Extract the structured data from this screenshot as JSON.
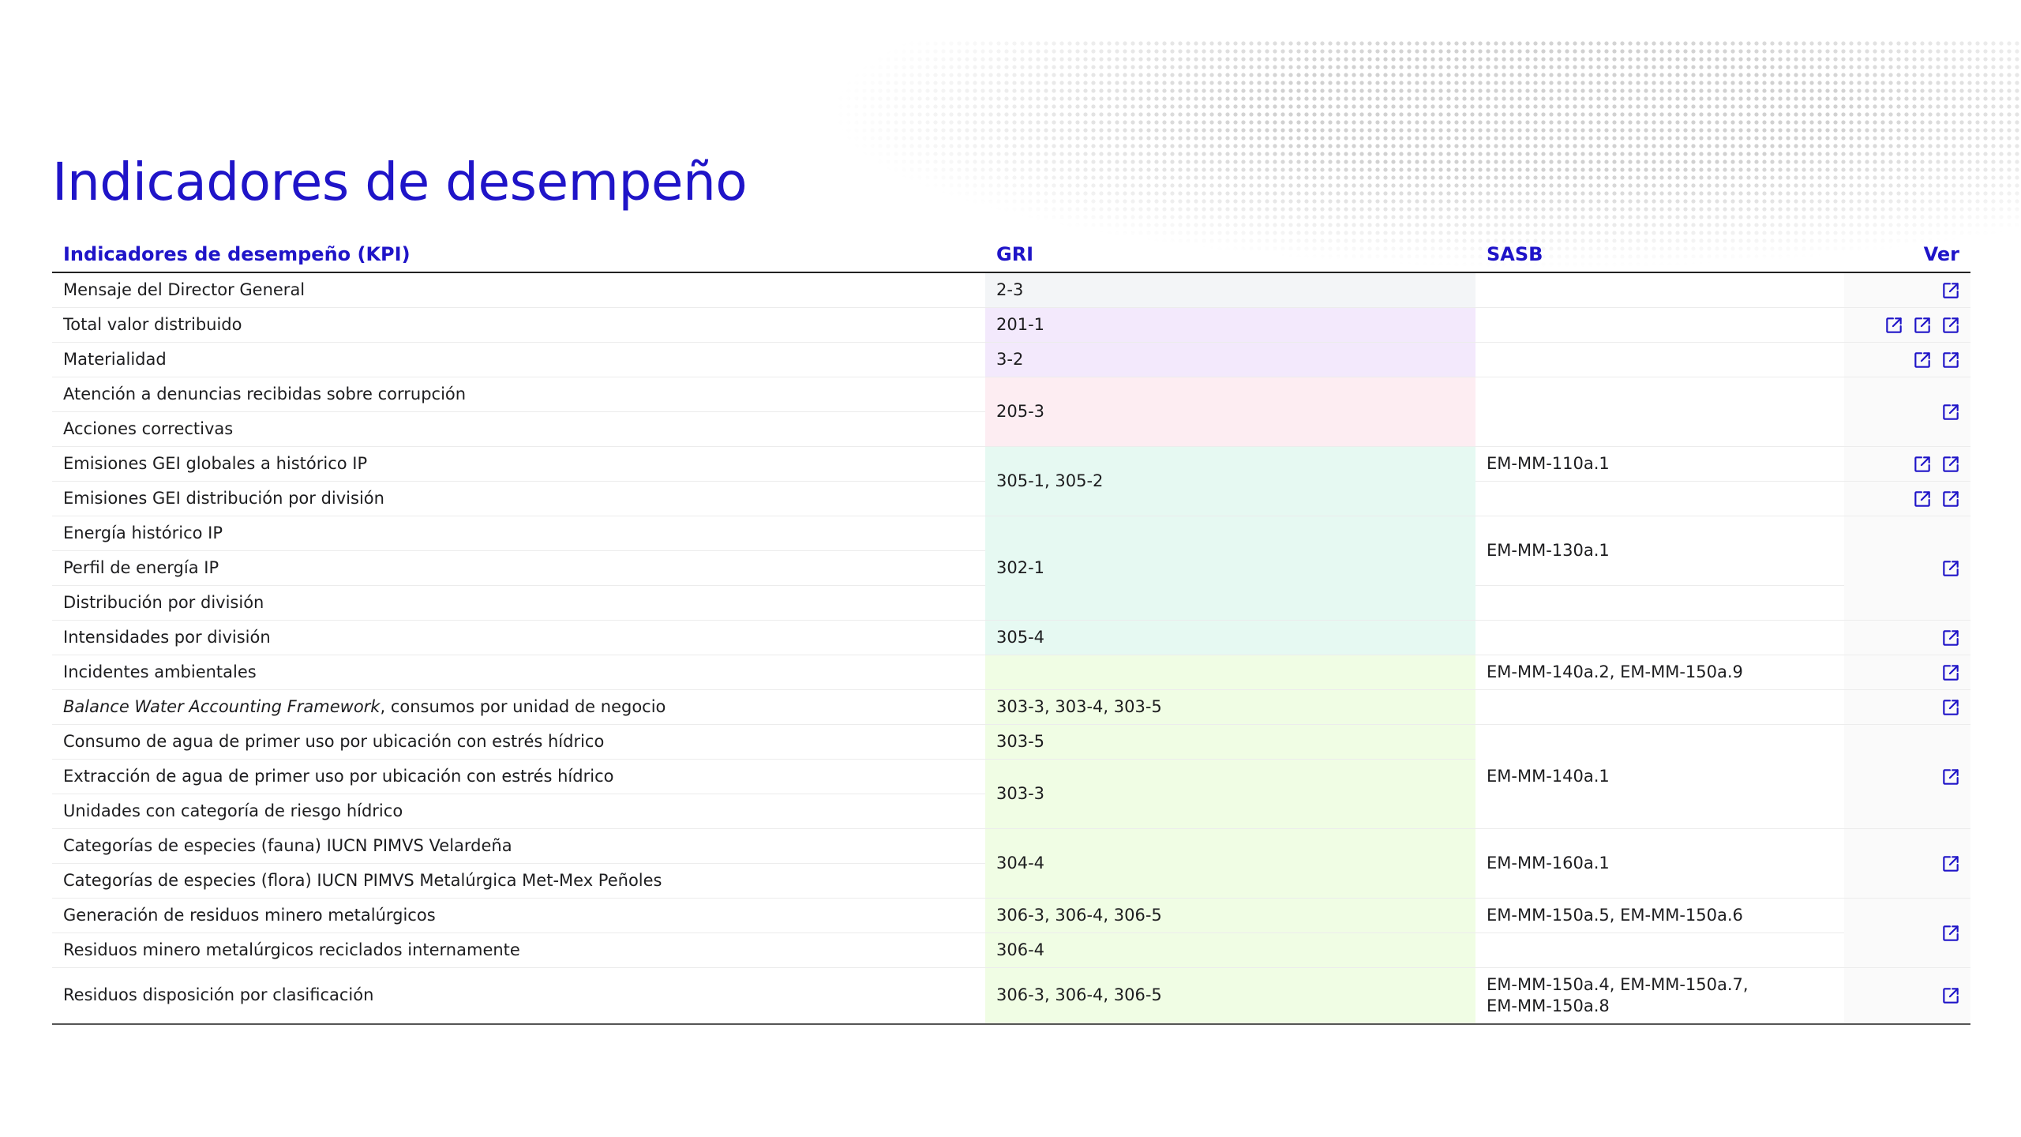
{
  "page": {
    "title": "Indicadores de desempeño"
  },
  "table": {
    "headers": {
      "kpi": "Indicadores de desempeño (KPI)",
      "gri": "GRI",
      "sasb": "SASB",
      "ver": "Ver"
    },
    "kpi": [
      "Mensaje del Director General",
      "Total valor distribuido",
      "Materialidad",
      "Atención a denuncias recibidas sobre corrupción",
      "Acciones correctivas",
      "Emisiones GEI globales a histórico IP",
      "Emisiones GEI distribución por división",
      "Energía histórico IP",
      "Perfil de energía IP",
      "Distribución por división",
      "Intensidades por división",
      "Incidentes ambientales",
      "Balance Water Accounting Framework",
      ", consumos por unidad de negocio",
      "Consumo de agua de primer uso por ubicación con estrés hídrico",
      "Extracción de agua de primer uso por ubicación con estrés hídrico",
      "Unidades con categoría de riesgo hídrico",
      "Categorías de especies (fauna) IUCN PIMVS Velardeña",
      "Categorías de especies (flora) IUCN PIMVS Metalúrgica Met-Mex Peñoles",
      "Generación de residuos minero metalúrgicos",
      "Residuos minero metalúrgicos reciclados internamente",
      "Residuos disposición por clasificación"
    ],
    "gri": [
      "2-3",
      "201-1",
      "3-2",
      "205-3",
      "305-1, 305-2",
      "302-1",
      "305-4",
      "303-3, 303-4, 303-5",
      "303-5",
      "303-3",
      "304-4",
      "306-3, 306-4, 306-5",
      "306-4",
      "306-3, 306-4, 306-5"
    ],
    "sasb": [
      "EM-MM-110a.1",
      "EM-MM-130a.1",
      "EM-MM-140a.2, EM-MM-150a.9",
      "EM-MM-140a.1",
      "EM-MM-160a.1",
      "EM-MM-150a.5, EM-MM-150a.6",
      "EM-MM-150a.4, EM-MM-150a.7,",
      "EM-MM-150a.8"
    ],
    "gri_colors": {
      "gray": "#f3f5f7",
      "purple": "#f3e9fc",
      "pink": "#fdedf2",
      "mint": "#e6f9f2",
      "lime": "#f0fde4"
    },
    "accent_color": "#1f14c8",
    "link_icon": "external-link-icon"
  }
}
